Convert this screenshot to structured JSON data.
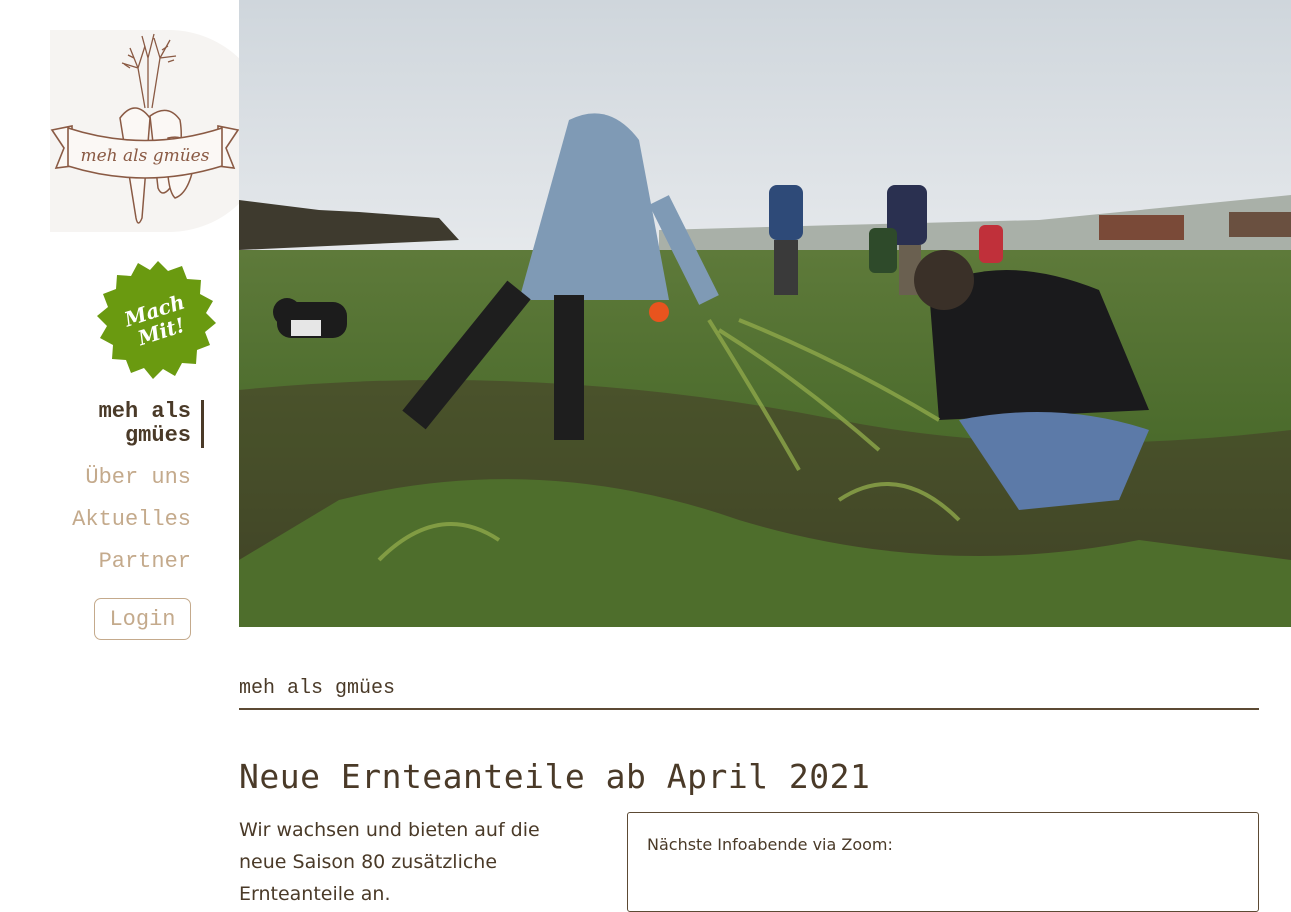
{
  "logo": {
    "text": "meh als gmües",
    "icon": "vegetable-banner-logo"
  },
  "badge": {
    "text": "Mach\nMit!",
    "color": "#6a9a10"
  },
  "nav": {
    "items": [
      {
        "label": "meh als\ngmües",
        "active": true
      },
      {
        "label": "Über uns",
        "active": false
      },
      {
        "label": "Aktuelles",
        "active": false
      },
      {
        "label": "Partner",
        "active": false
      }
    ],
    "login_label": "Login"
  },
  "hero": {
    "icon": "field-harvest-photo"
  },
  "breadcrumb": "meh als gmües",
  "article": {
    "title": "Neue Ernteanteile ab April 2021",
    "intro": "Wir wachsen und bieten auf die neue Saison 80 zusätzliche Ernteanteile an.",
    "info_box_text": "Nächste Infoabende via Zoom:"
  },
  "colors": {
    "text": "#4a3a28",
    "nav_inactive": "#c4aa8c",
    "accent_green": "#6a9a10"
  }
}
